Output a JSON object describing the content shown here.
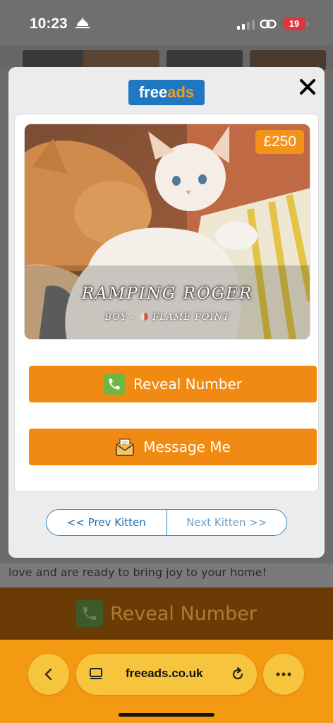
{
  "status_bar": {
    "time": "10:23",
    "battery": "19"
  },
  "background_page": {
    "description_text": "love and are ready to bring joy to your home!",
    "reveal_label": "Reveal Number"
  },
  "modal": {
    "logo": {
      "part1": "free",
      "part2": "ads"
    },
    "listing": {
      "price": "£250",
      "name": "RAMPING ROGER",
      "gender": "BOY -",
      "color": "FLAME POINT"
    },
    "reveal_button_label": "Reveal Number",
    "message_button_label": "Message Me",
    "pager": {
      "prev_label": "<< Prev Kitten",
      "next_label": "Next Kitten >>"
    }
  },
  "browser": {
    "url": "freeads.co.uk"
  },
  "colors": {
    "accent_orange": "#f08a12",
    "brand_blue": "#1f78c1",
    "phone_green": "#6fb645"
  }
}
